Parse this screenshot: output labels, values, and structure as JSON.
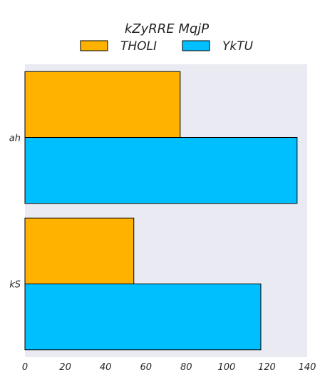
{
  "chart_data": {
    "type": "bar",
    "orientation": "horizontal",
    "title": "kZyRRE MqjP",
    "categories": [
      "ah",
      "kS"
    ],
    "series": [
      {
        "name": "THOLI",
        "values": [
          77,
          54
        ],
        "color": "#FFB300"
      },
      {
        "name": "YkTU",
        "values": [
          135,
          117
        ],
        "color": "#00BFFF"
      }
    ],
    "xlim": [
      0,
      140
    ],
    "xticks": [
      0,
      20,
      40,
      60,
      80,
      100,
      120,
      140
    ],
    "grid": false,
    "legend_position": "top-center"
  }
}
